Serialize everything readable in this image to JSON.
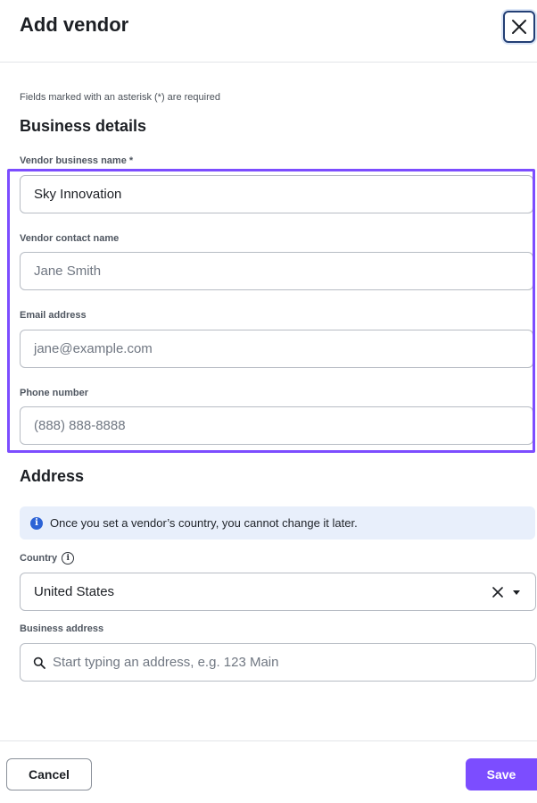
{
  "header": {
    "title": "Add vendor",
    "close_icon": "close-icon"
  },
  "form": {
    "required_note": "Fields marked with an asterisk (*) are required",
    "business_section_title": "Business details",
    "fields": {
      "business_name": {
        "label": "Vendor business name *",
        "value": "Sky Innovation"
      },
      "contact_name": {
        "label": "Vendor contact name",
        "placeholder": "Jane Smith"
      },
      "email": {
        "label": "Email address",
        "placeholder": "jane@example.com"
      },
      "phone": {
        "label": "Phone number",
        "placeholder": "(888) 888-8888"
      }
    },
    "address_section_title": "Address",
    "info_banner": "Once you set a vendor’s country, you cannot change it later.",
    "country": {
      "label": "Country",
      "value": "United States"
    },
    "business_address": {
      "label": "Business address",
      "placeholder": "Start typing an address, e.g. 123 Main"
    }
  },
  "footer": {
    "cancel_label": "Cancel",
    "save_label": "Save"
  },
  "colors": {
    "accent": "#7c4dff",
    "info_bg": "#e8effb",
    "info_icon": "#2c63d6"
  }
}
